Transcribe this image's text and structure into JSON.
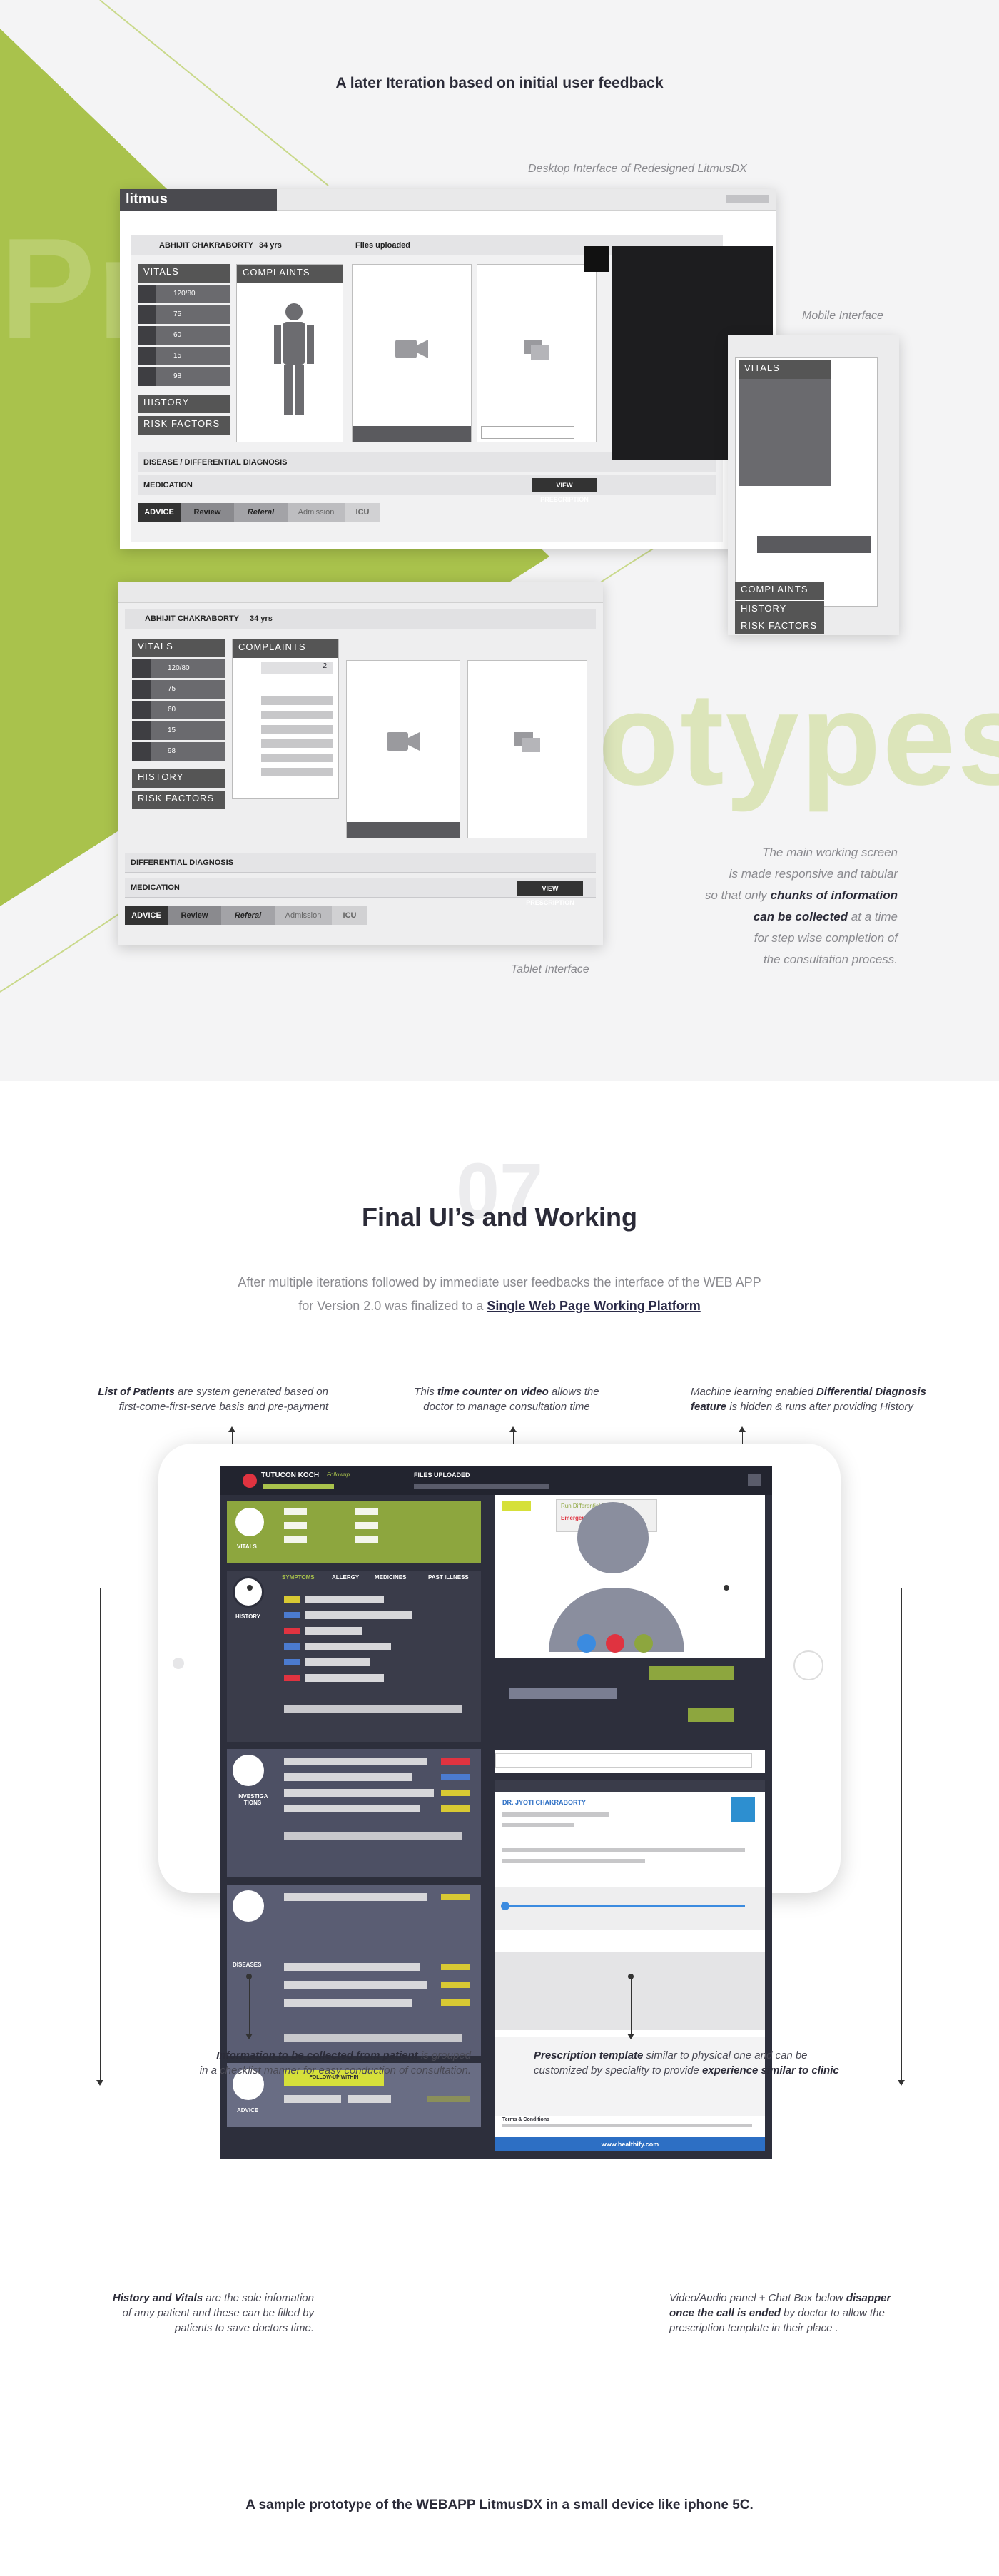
{
  "sec1": {
    "heading": "A later Iteration based on initial user feedback",
    "bg_word_left": "Pr",
    "bg_word_right": "otypes",
    "desktop_caption": "Desktop Interface of Redesigned LitmusDX",
    "mobile_caption": "Mobile Interface",
    "tablet_caption": "Tablet Interface",
    "desktop": {
      "logo": "litmus",
      "patient_name": "ABHIJIT CHAKRABORTY",
      "age": "34 yrs",
      "files_label": "Files uploaded",
      "vitals": "VITALS",
      "complaints": "COMPLAINTS",
      "vital_values": [
        "120/80",
        "75",
        "60",
        "15",
        "98"
      ],
      "history": "HISTORY",
      "risk": "RISK FACTORS",
      "diagnosis": "DISEASE / DIFFERENTIAL DIAGNOSIS",
      "medication": "MEDICATION",
      "view_rx": "VIEW PRESCRIPTION",
      "tabs": [
        "ADVICE",
        "Review",
        "Referal",
        "Admission",
        "ICU"
      ]
    },
    "mobile": {
      "vitals": "VITALS",
      "complaints": "COMPLAINTS",
      "history": "HISTORY",
      "risk": "RISK FACTORS"
    },
    "tablet": {
      "patient_name": "ABHIJIT CHAKRABORTY",
      "age": "34 yrs",
      "vitals": "VITALS",
      "complaints": "COMPLAINTS",
      "vital_values": [
        "120/80",
        "75",
        "60",
        "15",
        "98"
      ],
      "complaint_count": "2",
      "history": "HISTORY",
      "risk": "RISK FACTORS",
      "diagnosis": "DIFFERENTIAL DIAGNOSIS",
      "medication": "MEDICATION",
      "view_rx": "VIEW PRESCRIPTION",
      "tabs": [
        "ADVICE",
        "Review",
        "Referal",
        "Admission",
        "ICU"
      ]
    },
    "side_note": {
      "l1": "The main working screen",
      "l2": "is made responsive and tabular",
      "l3a": "so that only ",
      "l3b": "chunks of information",
      "l4a": "can be collected",
      "l4b": " at a time",
      "l5": "for step wise completion of",
      "l6": "the consultation process."
    }
  },
  "sec2": {
    "big_number": "07",
    "heading": "Final UI’s and Working",
    "intro1": "After multiple iterations followed by immediate user feedbacks the interface of the WEB APP",
    "intro2a": "for Version 2.0 was finalized to a ",
    "intro2b": "Single Web Page Working Platform",
    "notes": {
      "patients_b": "List of Patients",
      "patients_t1": " are system generated based on",
      "patients_t2": "first-come-first-serve basis and pre-payment",
      "timer_a": "This ",
      "timer_b": "time counter on video",
      "timer_c": " allows the",
      "timer_t2": "doctor to manage consultation time",
      "ml_a": "Machine learning enabled ",
      "ml_b": "Differential Diagnosis",
      "ml_c": "feature",
      "ml_d": " is hidden & runs after providing History",
      "info_b": "Information to be collected from patient",
      "info_t1": " is grouped",
      "info_t2": "in a checklist manner for easy conduction of consultation.",
      "rx_b": "Prescription template",
      "rx_t1": " similar to physical one and can be",
      "rx_t2a": "customized by speciality to provide ",
      "rx_t2b": "experience similar to clinic",
      "hist_b": "History and Vitals",
      "hist_t1": " are the sole infomation",
      "hist_t2": "of amy patient and these can be filled by",
      "hist_t3": "patients to save doctors time.",
      "vid_a": "Video/Audio panel + Chat Box below ",
      "vid_b": "disapper",
      "vid_c": "once the call is ended",
      "vid_d": " by doctor to allow the",
      "vid_t3": "prescription template in their place ."
    },
    "app": {
      "patient": "TUTUCON KOCH",
      "followup": "Followup",
      "files": "FILES UPLOADED",
      "vitals": "VITALS",
      "history": "HISTORY",
      "tabs": [
        "SYMPTOMS",
        "ALLERGY",
        "MEDICINES",
        "PAST ILLNESS"
      ],
      "investigations": "INVESTIGA TIONS",
      "diseases": "DISEASES",
      "advice": "ADVICE",
      "followup_btn": "FOLLOW-UP WITHIN",
      "diff_dx": "Run Differential Diagnosis",
      "emergency": "Emergency ICU",
      "doctor": "DR. JYOTI CHAKRABORTY",
      "rx_banner": "www.healthify.com",
      "terms": "Terms & Conditions"
    },
    "footer": "A sample prototype of the WEBAPP LitmusDX in a small device like iphone 5C."
  },
  "colors": {
    "accent": "#a9c24c",
    "dark": "#2d2f3c",
    "text": "#2b2b38",
    "red": "#e03340",
    "blue": "#2d6fc4"
  }
}
